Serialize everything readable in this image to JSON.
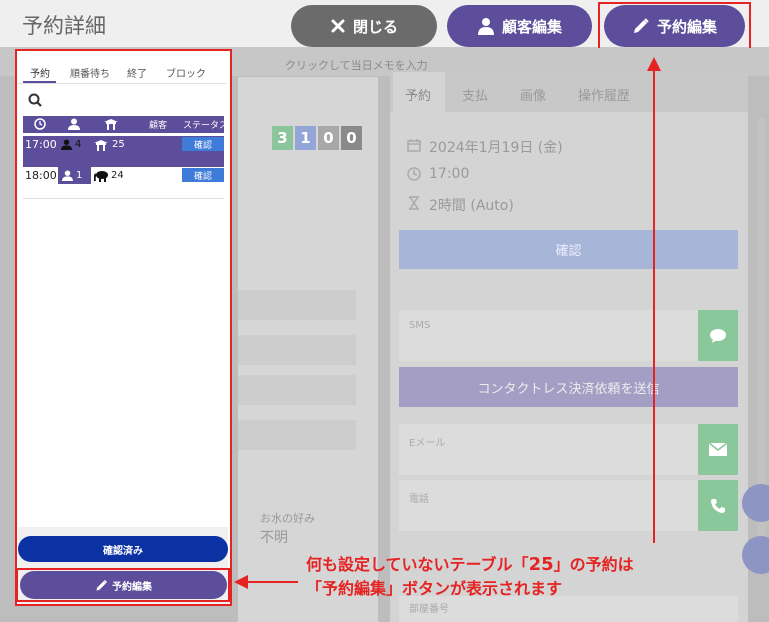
{
  "header": {
    "title": "予約詳細",
    "close_label": "閉じる",
    "customer_edit_label": "顧客編集",
    "reservation_edit_label": "予約編集"
  },
  "background": {
    "memo_placeholder": "クリックして当日メモを入力",
    "counters": [
      "3",
      "1",
      "0",
      "0"
    ],
    "counter_colors": [
      "#8cc59b",
      "#94a6d8",
      "#a8a8a8",
      "#8a8a8a"
    ],
    "water_label": "お水の好み",
    "water_value": "不明"
  },
  "left_panel": {
    "tabs": [
      "予約",
      "順番待ち",
      "終了",
      "ブロック"
    ],
    "active_tab": "予約",
    "columns": {
      "customer": "顧客",
      "status": "ステータス"
    },
    "rows": [
      {
        "time": "17:00",
        "guests": "4",
        "table": "25",
        "status": "確認",
        "selected": true
      },
      {
        "time": "18:00",
        "guests": "1",
        "table": "24",
        "status": "確認",
        "selected": false
      }
    ],
    "confirmed_button": "確認済み",
    "edit_button": "予約編集"
  },
  "detail_panel": {
    "tabs": [
      "予約",
      "支払",
      "画像",
      "操作履歴"
    ],
    "active_tab": "予約",
    "date": "2024年1月19日 (金)",
    "time": "17:00",
    "duration": "2時間 (Auto)",
    "status_label": "確認",
    "sms_label": "SMS",
    "contactless_label": "コンタクトレス決済依頼を送信",
    "email_label": "Eメール",
    "phone_label": "電話",
    "room_label": "部屋番号"
  },
  "annotation": {
    "line1_pre": "何も設定していないテーブル「",
    "line1_num": "25",
    "line1_post": "」の予約は",
    "line2": "「予約編集」ボタンが表示されます"
  },
  "colors": {
    "accent": "#5d4e9b",
    "highlight": "#e52323",
    "confirm_blue": "#3f7bd9"
  }
}
